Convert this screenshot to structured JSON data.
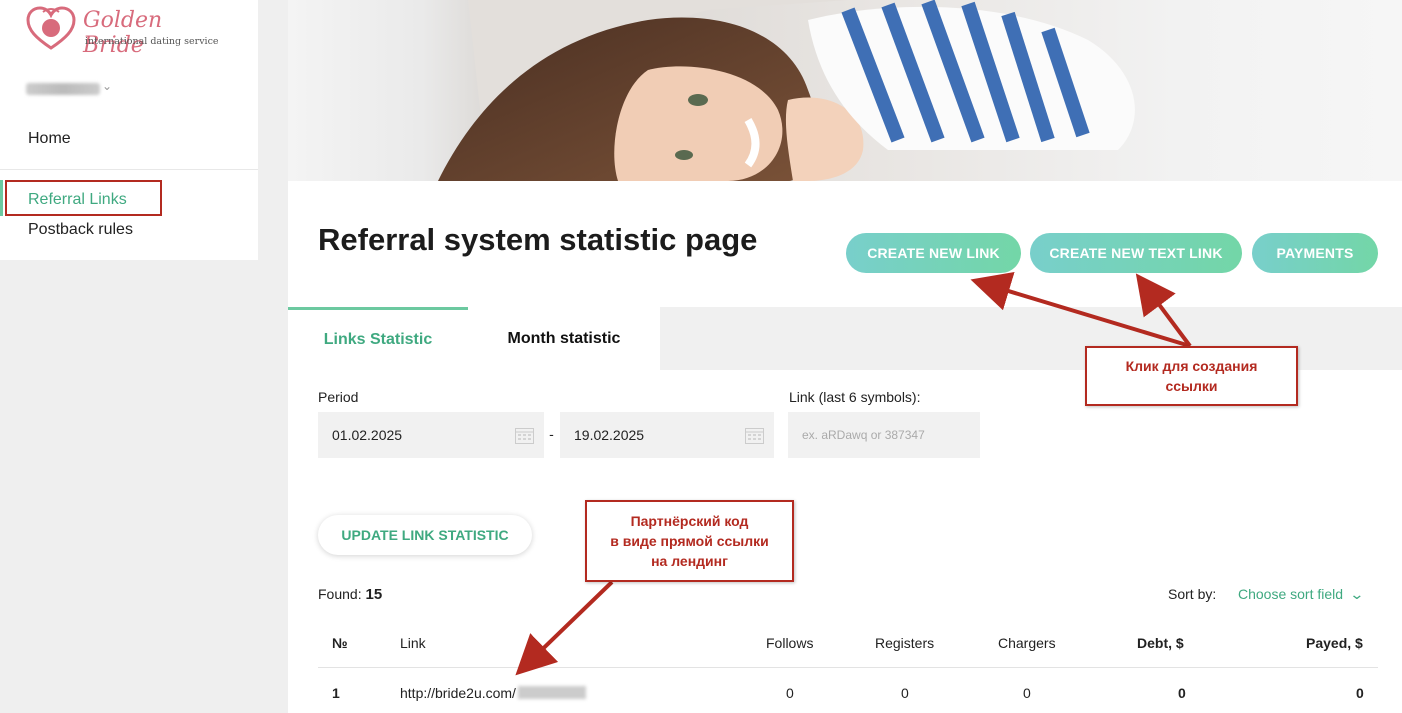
{
  "brand": {
    "name": "Golden Bride",
    "tagline": "international dating service"
  },
  "sidebar": {
    "items": [
      {
        "label": "Home"
      },
      {
        "label": "Referral Links"
      },
      {
        "label": "Postback rules"
      }
    ]
  },
  "page": {
    "title": "Referral system statistic page",
    "buttons": {
      "create_link": "CREATE NEW LINK",
      "create_text_link": "CREATE NEW TEXT LINK",
      "payments": "PAYMENTS"
    },
    "tabs": [
      {
        "label": "Links Statistic",
        "active": true
      },
      {
        "label": "Month statistic",
        "active": false
      }
    ]
  },
  "filters": {
    "period_label": "Period",
    "date_from": "01.02.2025",
    "date_to": "19.02.2025",
    "separator": "-",
    "link_label": "Link (last 6 symbols):",
    "link_placeholder": "ex. aRDawq or 387347",
    "update_button": "UPDATE LINK STATISTIC"
  },
  "results": {
    "found_label": "Found:",
    "found_count": "15",
    "sort_label": "Sort by:",
    "sort_value": "Choose sort field"
  },
  "table": {
    "headers": [
      "№",
      "Link",
      "Follows",
      "Registers",
      "Chargers",
      "Debt, $",
      "Payed, $"
    ],
    "rows": [
      {
        "num": "1",
        "link": "http://bride2u.com/",
        "follows": "0",
        "registers": "0",
        "chargers": "0",
        "debt": "0",
        "payed": "0"
      }
    ]
  },
  "annotations": {
    "create_hint": [
      "Клик для создания",
      "ссылки"
    ],
    "code_hint": [
      "Партнёрский код",
      "в виде прямой ссылки",
      "на лендинг"
    ]
  },
  "colors": {
    "accent": "#3fa980",
    "button_gradient_start": "#78cfcb",
    "button_gradient_end": "#73d6a7",
    "annotation": "#b32a20",
    "brand": "#d86b7c"
  }
}
